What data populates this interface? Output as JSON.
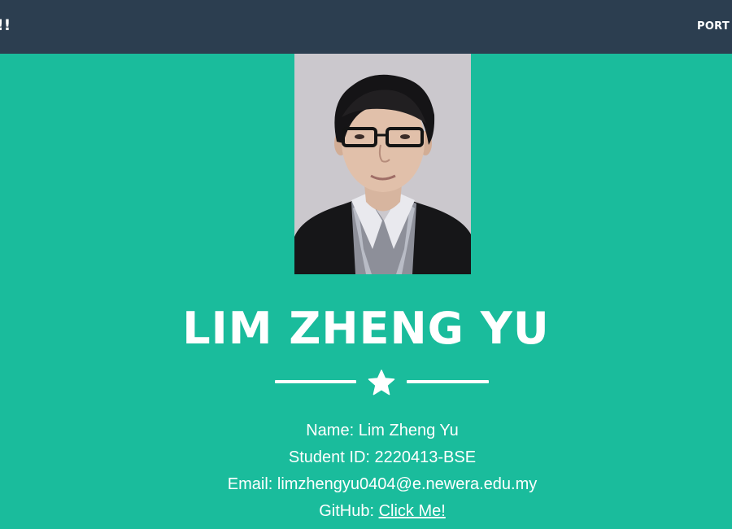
{
  "navbar": {
    "brand": "!!",
    "link_label": "PORT"
  },
  "profile": {
    "photo_alt": "Portrait photo of Lim Zheng Yu",
    "heading": "LIM ZHENG YU",
    "divider_icon": "star-icon",
    "name_label": "Name: ",
    "name_value": "Lim Zheng Yu",
    "student_id_label": "Student ID: ",
    "student_id_value": "2220413-BSE",
    "email_label": "Email: ",
    "email_value": "limzhengyu0404@e.newera.edu.my",
    "github_label": "GitHub: ",
    "github_link_text": "Click Me!"
  },
  "colors": {
    "navbar_bg": "#2c3e50",
    "page_bg": "#1abc9c",
    "text": "#ffffff"
  }
}
